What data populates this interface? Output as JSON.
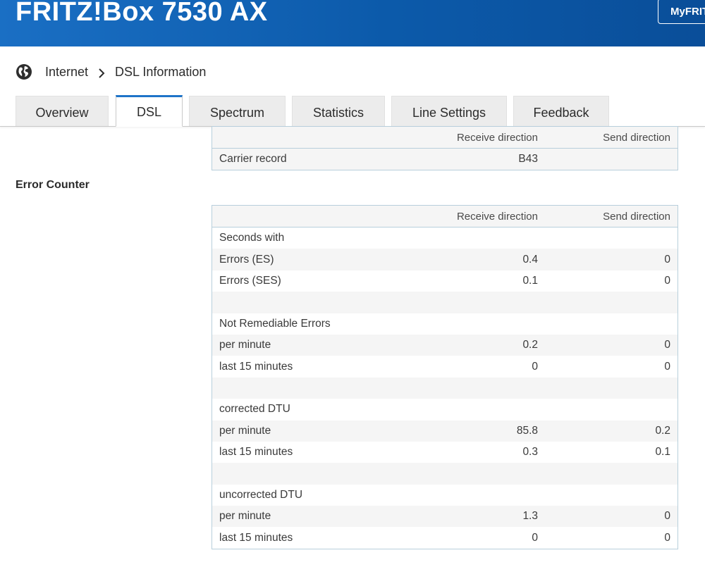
{
  "header": {
    "title": "FRITZ!Box 7530 AX",
    "myfritz_label": "MyFRITZ!"
  },
  "breadcrumb": {
    "items": [
      "Internet",
      "DSL Information"
    ]
  },
  "tabs": [
    {
      "label": "Overview",
      "active": false
    },
    {
      "label": "DSL",
      "active": true
    },
    {
      "label": "Spectrum",
      "active": false
    },
    {
      "label": "Statistics",
      "active": false
    },
    {
      "label": "Line Settings",
      "active": false
    },
    {
      "label": "Feedback",
      "active": false
    }
  ],
  "carrier_table": {
    "columns": [
      "",
      "Receive direction",
      "Send direction"
    ],
    "rows": [
      [
        "Carrier record",
        "B43",
        ""
      ]
    ]
  },
  "error_counter": {
    "heading": "Error Counter",
    "columns": [
      "",
      "Receive direction",
      "Send direction"
    ],
    "rows": [
      [
        "Seconds with",
        "",
        ""
      ],
      [
        "Errors (ES)",
        "0.4",
        "0"
      ],
      [
        "Errors (SES)",
        "0.1",
        "0"
      ],
      [
        "",
        "",
        ""
      ],
      [
        "Not Remediable Errors",
        "",
        ""
      ],
      [
        "per minute",
        "0.2",
        "0"
      ],
      [
        "last 15 minutes",
        "0",
        "0"
      ],
      [
        "",
        "",
        ""
      ],
      [
        "corrected DTU",
        "",
        ""
      ],
      [
        "per minute",
        "85.8",
        "0.2"
      ],
      [
        "last 15 minutes",
        "0.3",
        "0.1"
      ],
      [
        "",
        "",
        ""
      ],
      [
        "uncorrected DTU",
        "",
        ""
      ],
      [
        "per minute",
        "1.3",
        "0"
      ],
      [
        "last 15 minutes",
        "0",
        "0"
      ]
    ]
  },
  "colors": {
    "header_blue": "#0c5aaa",
    "tab_active_accent": "#1f74c9",
    "table_border": "#b8cfdc"
  },
  "icons": {
    "breadcrumb_icon": "globe-icon",
    "breadcrumb_separator": "chevron-right-icon"
  }
}
